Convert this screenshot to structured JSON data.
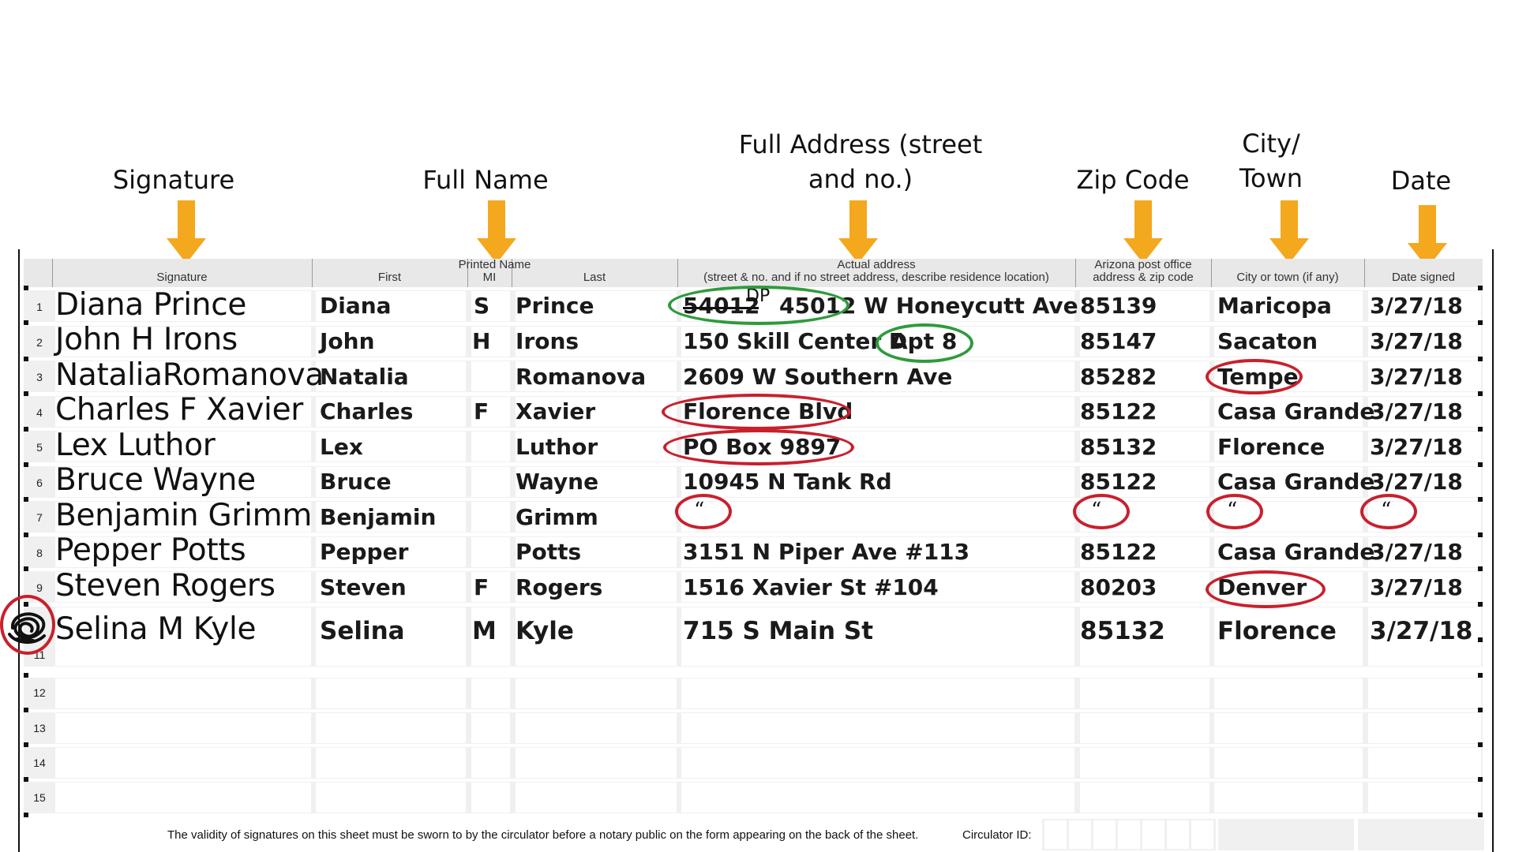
{
  "annotations": [
    {
      "id": "signature",
      "text": "Signature"
    },
    {
      "id": "full-name",
      "text": "Full Name"
    },
    {
      "id": "full-address",
      "line1": "Full Address (street",
      "line2": "and no.)"
    },
    {
      "id": "zip-code",
      "text": "Zip Code"
    },
    {
      "id": "city-town",
      "line1": "City/",
      "line2": "Town"
    },
    {
      "id": "date",
      "text": "Date"
    }
  ],
  "header": {
    "signature": "Signature",
    "printed_name": "Printed Name",
    "first": "First",
    "mi": "MI",
    "last": "Last",
    "address_line1": "Actual address",
    "address_line2": "(street & no. and if no street address, describe residence location)",
    "zip_line1": "Arizona post office",
    "zip_line2": "address & zip code",
    "city": "City or town (if any)",
    "date": "Date signed"
  },
  "rows": [
    {
      "num": "1",
      "signature": "Diana Prince",
      "first": "Diana",
      "mi": "S",
      "last": "Prince",
      "address": "45012 W Honeycutt Ave",
      "zip": "85139",
      "city": "Maricopa",
      "date": "3/27/18"
    },
    {
      "num": "2",
      "signature": "John H Irons",
      "first": "John",
      "mi": "H",
      "last": "Irons",
      "address": "150 Skill Center D",
      "zip": "85147",
      "city": "Sacaton",
      "date": "3/27/18"
    },
    {
      "num": "3",
      "signature": "NataliaRomanova",
      "first": "Natalia",
      "mi": "",
      "last": "Romanova",
      "address": "2609 W Southern Ave",
      "zip": "85282",
      "city": "Tempe",
      "date": "3/27/18"
    },
    {
      "num": "4",
      "signature": "Charles F Xavier",
      "first": "Charles",
      "mi": "F",
      "last": "Xavier",
      "address": "Florence Blvd",
      "zip": "85122",
      "city": "Casa Grande",
      "date": "3/27/18"
    },
    {
      "num": "5",
      "signature": "Lex Luthor",
      "first": "Lex",
      "mi": "",
      "last": "Luthor",
      "address": "PO Box 9897",
      "zip": "85132",
      "city": "Florence",
      "date": "3/27/18"
    },
    {
      "num": "6",
      "signature": "Bruce Wayne",
      "first": "Bruce",
      "mi": "",
      "last": "Wayne",
      "address": "10945 N Tank Rd",
      "zip": "85122",
      "city": "Casa Grande",
      "date": "3/27/18"
    },
    {
      "num": "7",
      "signature": "Benjamin Grimm",
      "first": "Benjamin",
      "mi": "",
      "last": "Grimm",
      "address": "“",
      "zip": "“",
      "city": "“",
      "date": "“"
    },
    {
      "num": "8",
      "signature": "Pepper Potts",
      "first": "Pepper",
      "mi": "",
      "last": "Potts",
      "address": "3151 N Piper Ave #113",
      "zip": "85122",
      "city": "Casa Grande",
      "date": "3/27/18"
    },
    {
      "num": "9",
      "signature": "Steven Rogers",
      "first": "Steven",
      "mi": "F",
      "last": "Rogers",
      "address": "1516 Xavier St #104",
      "zip": "80203",
      "city": "Denver",
      "date": "3/27/18"
    },
    {
      "num": "10",
      "signature": "Selina M Kyle",
      "first": "Selina",
      "mi": "M",
      "last": "Kyle",
      "address": "715 S Main St",
      "zip": "85132",
      "city": "Florence",
      "date": "3/27/18"
    }
  ],
  "edits": {
    "struck_number": "54012",
    "initials": "DP",
    "apartment": "Apt 8"
  },
  "empty_rows": [
    "11",
    "12",
    "13",
    "14",
    "15"
  ],
  "footer": {
    "notice": "The validity of signatures on this sheet must be sworn to by the circulator before a notary public on the form appearing on the back of the sheet.",
    "circulator_label": "Circulator ID:"
  },
  "colors": {
    "arrow": "#f4a81d",
    "error_circle": "#c8202d",
    "ok_circle": "#2e9b3b"
  }
}
